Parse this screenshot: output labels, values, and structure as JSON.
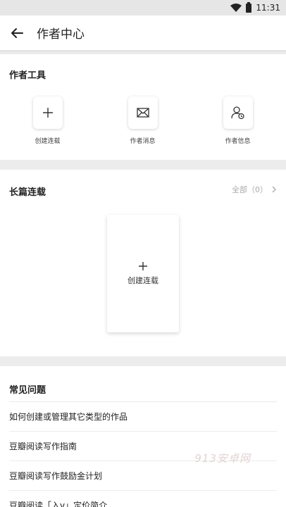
{
  "status_bar": {
    "time": "11:31",
    "icons": [
      "wifi-icon",
      "battery-icon"
    ]
  },
  "app_bar": {
    "back_icon": "arrow-left-icon",
    "title": "作者中心"
  },
  "tools": {
    "title": "作者工具",
    "items": [
      {
        "label": "创建连载",
        "icon": "plus-icon"
      },
      {
        "label": "作者消息",
        "icon": "envelope-icon"
      },
      {
        "label": "作者信息",
        "icon": "user-info-icon"
      }
    ]
  },
  "serial": {
    "title": "长篇连载",
    "all_label": "全部（0）",
    "create_card": {
      "icon": "plus-icon",
      "label": "创建连载"
    }
  },
  "faq": {
    "title": "常见问题",
    "items": [
      "如何创建或管理其它类型的作品",
      "豆瓣阅读写作指南",
      "豆瓣阅读写作鼓励金计划",
      "豆瓣阅读「入v」定价简介"
    ]
  },
  "watermark": "913安卓网"
}
